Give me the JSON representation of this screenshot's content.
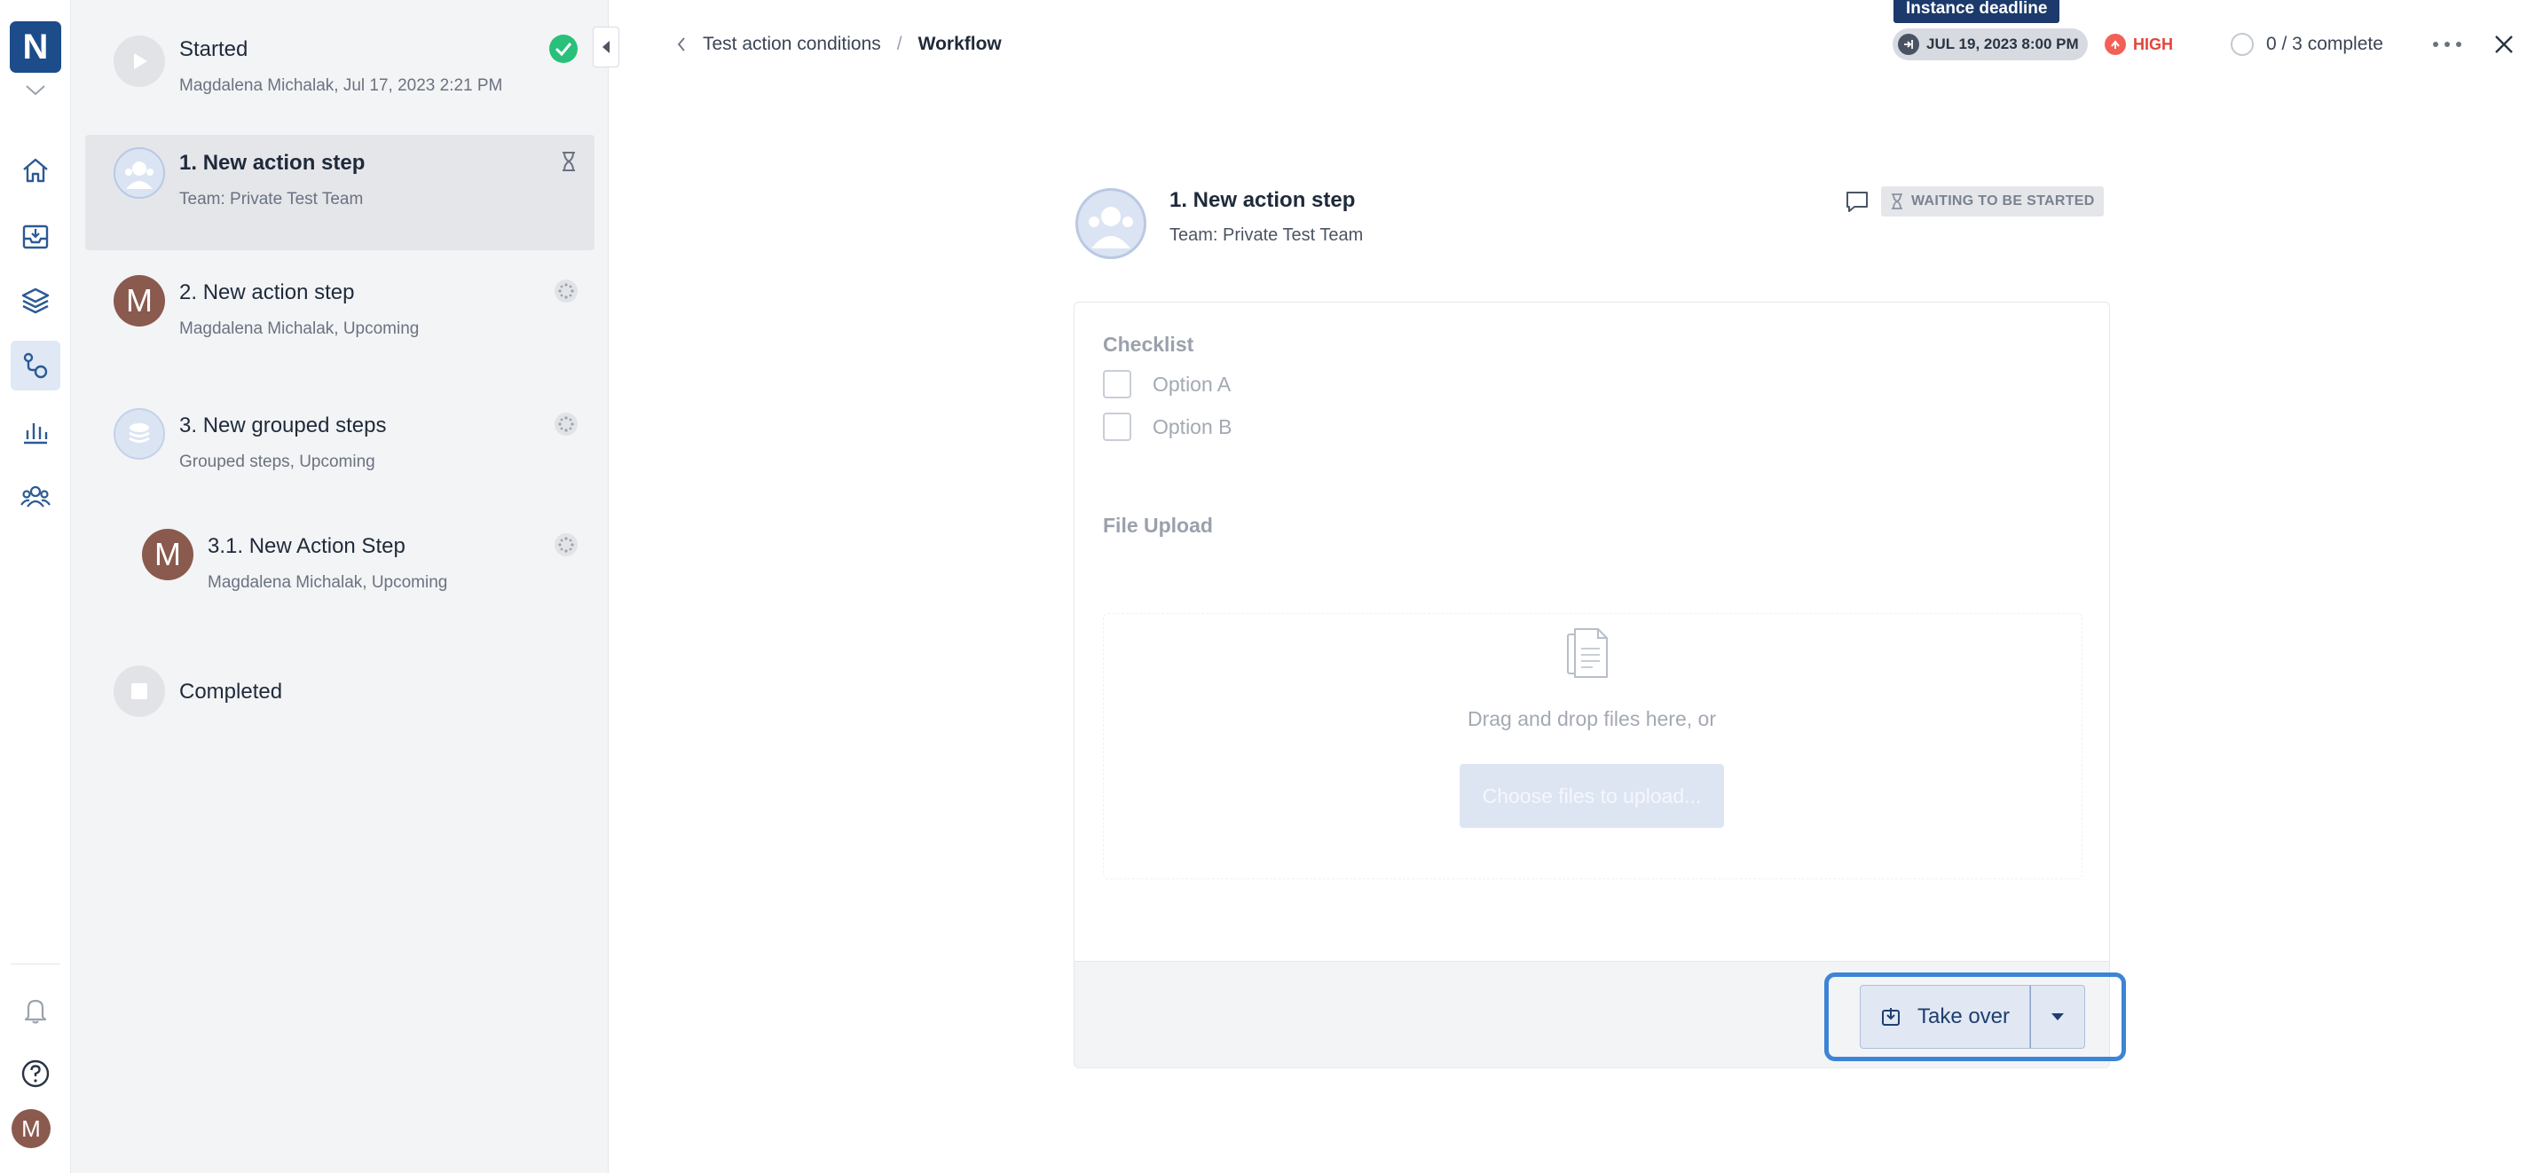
{
  "app": {
    "logo_letter": "N",
    "user_initial": "M",
    "accent_color": "#1c4c8a"
  },
  "rail": {
    "icons": [
      "home-icon",
      "inbox-icon",
      "layers-icon",
      "workflow-icon",
      "chart-icon",
      "team-icon",
      "bell-icon",
      "help-icon"
    ],
    "active": "workflow-icon"
  },
  "steps": {
    "started": {
      "title": "Started",
      "sub": "Magdalena Michalak, Jul 17, 2023 2:21 PM",
      "state_icon": "check-circle-icon"
    },
    "items": [
      {
        "number": "1.",
        "title": "New action step",
        "sub": "Team: Private Test Team",
        "state_icon": "hourglass-icon",
        "active": true,
        "marker": "team-avatar"
      },
      {
        "number": "2.",
        "title": "New action step",
        "sub": "Magdalena Michalak, Upcoming",
        "state_icon": "pending-icon",
        "active": false,
        "marker": "M"
      },
      {
        "number": "3.",
        "title": "New grouped steps",
        "sub": "Grouped steps, Upcoming",
        "state_icon": "pending-icon",
        "active": false,
        "marker": "group-icon"
      },
      {
        "number": "3.1.",
        "title": "New Action Step",
        "sub": "Magdalena Michalak, Upcoming",
        "state_icon": "pending-icon",
        "active": false,
        "marker": "M"
      }
    ],
    "completed": {
      "title": "Completed"
    }
  },
  "header": {
    "breadcrumb_parent": "Test action conditions",
    "breadcrumb_sep": "/",
    "breadcrumb_current": "Workflow",
    "deadline_tooltip": "Instance deadline",
    "deadline": "JUL 19, 2023 8:00 PM",
    "priority": "HIGH",
    "priority_color": "#e0453a",
    "progress": "0 / 3 complete"
  },
  "detail": {
    "title": "1. New action step",
    "sub": "Team: Private Test Team",
    "status": "WAITING TO BE STARTED",
    "checklist_label": "Checklist",
    "options": [
      "Option A",
      "Option B"
    ],
    "file_upload_label": "File Upload",
    "dropzone_text": "Drag and drop files here, or",
    "choose_button": "Choose files to upload...",
    "take_over": "Take over",
    "focus_color": "#3d84d6"
  }
}
